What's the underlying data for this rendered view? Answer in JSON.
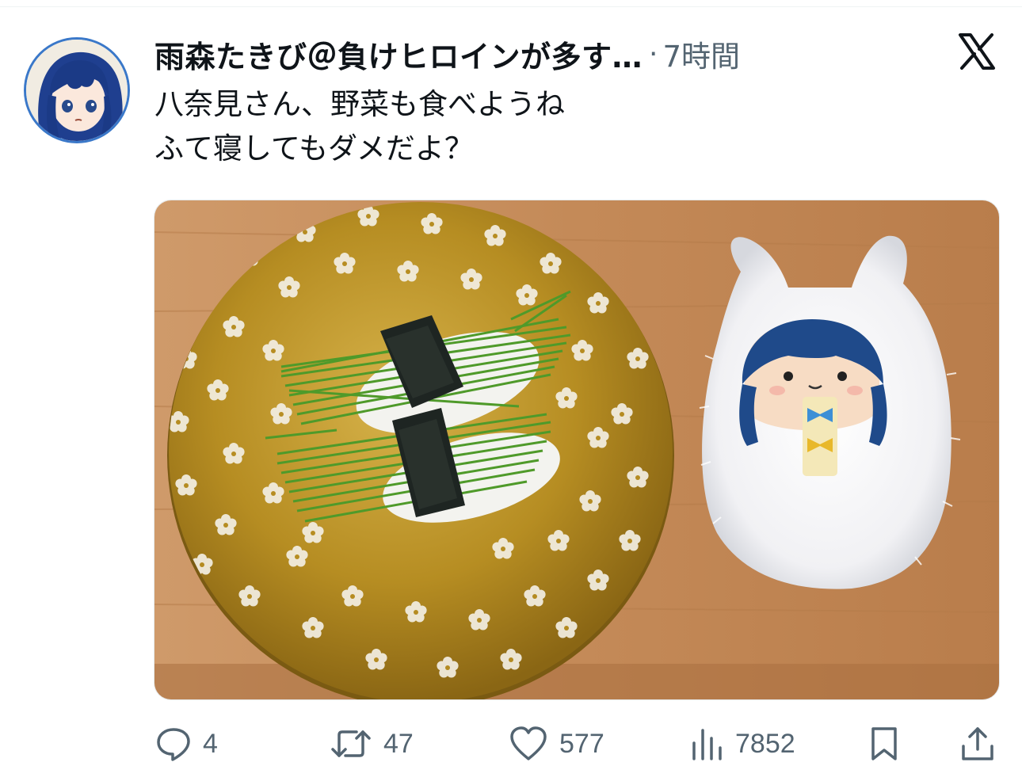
{
  "tweet": {
    "author_display": "雨森たきび＠負けヒロインが多す…",
    "separator": "·",
    "timestamp": "7時間",
    "text_lines": [
      "八奈見さん、野菜も食べようね",
      "ふて寝してもダメだよ？"
    ],
    "media_description_icon": "photo"
  },
  "actions": {
    "reply_count": "4",
    "retweet_count": "47",
    "like_count": "577",
    "views_count": "7852"
  },
  "icons": {
    "platform": "x-logo-icon",
    "reply": "reply-icon",
    "retweet": "retweet-icon",
    "like": "heart-icon",
    "views": "views-bar-chart-icon",
    "bookmark": "bookmark-icon",
    "share": "share-icon"
  },
  "colors": {
    "text_primary": "#0f1419",
    "text_secondary": "#536471",
    "avatar_border": "#3a78c9",
    "plate_gold": "#b8901f",
    "table_wood": "#c98e5c"
  }
}
